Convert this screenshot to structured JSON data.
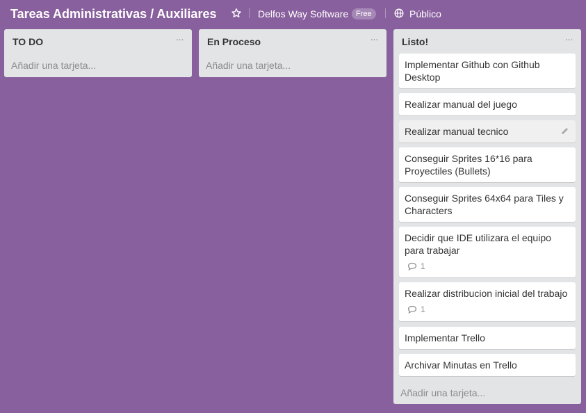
{
  "header": {
    "board_title": "Tareas Administrativas / Auxiliares",
    "team_name": "Delfos Way Software",
    "team_badge": "Free",
    "visibility": "Público"
  },
  "lists": [
    {
      "title": "TO DO",
      "add_card": "Añadir una tarjeta...",
      "cards": []
    },
    {
      "title": "En Proceso",
      "add_card": "Añadir una tarjeta...",
      "cards": []
    },
    {
      "title": "Listo!",
      "add_card": "Añadir una tarjeta...",
      "cards": [
        {
          "text": "Implementar Github con Github Desktop"
        },
        {
          "text": "Realizar manual del juego"
        },
        {
          "text": "Realizar manual tecnico"
        },
        {
          "text": "Conseguir Sprites 16*16 para Proyectiles (Bullets)"
        },
        {
          "text": "Conseguir Sprites 64x64 para Tiles y Characters"
        },
        {
          "text": "Decidir que IDE utilizara el equipo para trabajar",
          "comments": "1"
        },
        {
          "text": "Realizar distribucion inicial del trabajo",
          "comments": "1"
        },
        {
          "text": "Implementar Trello"
        },
        {
          "text": "Archivar Minutas en Trello"
        }
      ]
    }
  ],
  "icons": {
    "star": "star-outline-icon",
    "globe": "globe-icon",
    "menu": "ellipsis-icon",
    "comment": "comment-icon",
    "edit": "pencil-icon"
  },
  "colors": {
    "board_bg": "#89609e",
    "list_bg": "#e2e4e6",
    "card_bg": "#ffffff"
  }
}
